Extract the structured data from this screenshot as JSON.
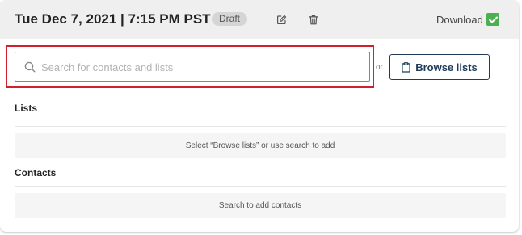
{
  "header": {
    "title": "Tue Dec 7, 2021 | 7:15 PM PST",
    "status_badge": "Draft",
    "edit_icon": "pencil-square-icon",
    "delete_icon": "trash-icon",
    "download_label": "Download",
    "download_checked": true
  },
  "search": {
    "placeholder": "Search for contacts and lists",
    "value": "",
    "icon": "search-icon"
  },
  "or_text": "or",
  "browse_button": {
    "label": "Browse lists",
    "icon": "clipboard-icon"
  },
  "lists_section": {
    "title": "Lists",
    "empty_message": "Select “Browse lists” or use search to add"
  },
  "contacts_section": {
    "title": "Contacts",
    "empty_message": "Search to add contacts"
  },
  "colors": {
    "header_bg": "#efefef",
    "accent_dark": "#1f3c5a",
    "checkbox_green": "#4caf50",
    "highlight_red": "#d21f2c",
    "search_border": "#5b8fbd"
  }
}
